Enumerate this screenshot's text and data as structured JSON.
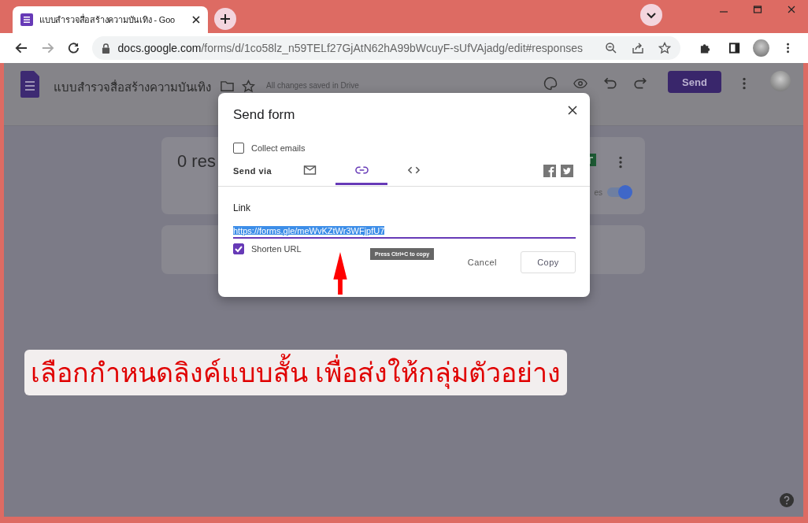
{
  "browser": {
    "tab_title": "แบบสำรวจสื่อสร้างความบันเทิง - Goo",
    "url_host": "docs.google.com",
    "url_path": "/forms/d/1co58lz_n59TELf27GjAtN62hA99bWcuyF-sUfVAjadg/edit#responses"
  },
  "header": {
    "title": "แบบสำรวจสื่อสร้างความบันเทิง",
    "save_status": "All changes saved in Drive",
    "send_button": "Send"
  },
  "responses_card": {
    "heading": "0 res",
    "toggle_label": "es",
    "accepting": true
  },
  "dialog": {
    "title": "Send form",
    "collect_emails": {
      "label": "Collect emails",
      "checked": false
    },
    "send_via_label": "Send via",
    "methods": [
      {
        "kind": "email",
        "selected": false
      },
      {
        "kind": "link",
        "selected": true
      },
      {
        "kind": "embed",
        "selected": false
      }
    ],
    "link_label": "Link",
    "link_value": "https://forms.gle/meWvKZtWr3WFjpfU7",
    "tooltip": "Press Ctrl+C to copy",
    "shorten": {
      "label": "Shorten URL",
      "checked": true
    },
    "cancel_button": "Cancel",
    "copy_button": "Copy"
  },
  "annotation": {
    "text": "เลือกกำหนดลิงค์แบบสั้น เพื่อส่งให้กลุ่มตัวอย่าง"
  }
}
